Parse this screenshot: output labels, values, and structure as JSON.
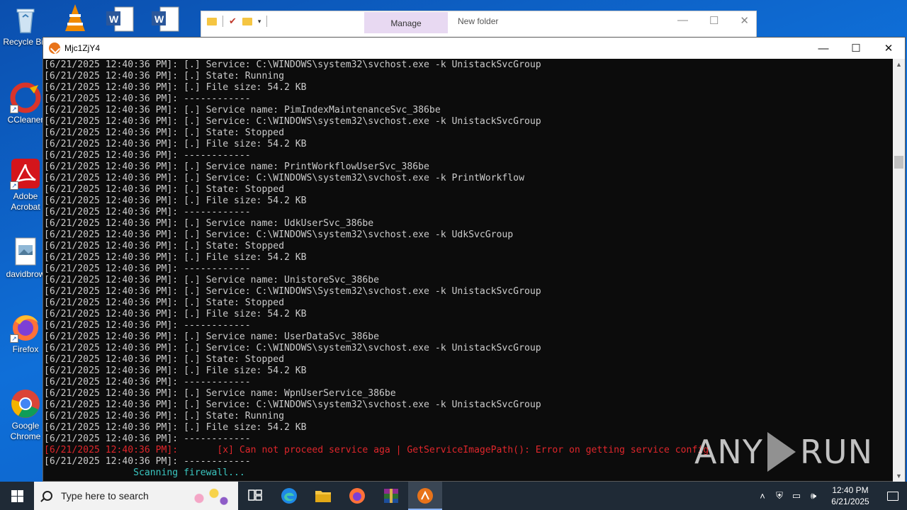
{
  "desktop": {
    "icons": [
      {
        "label": "Recycle Bin"
      },
      {
        "label": "CCleaner"
      },
      {
        "label": "Adobe Acrobat"
      },
      {
        "label": "davidbrow"
      },
      {
        "label": "Firefox"
      },
      {
        "label": "Google Chrome"
      }
    ]
  },
  "explorer": {
    "manage_tab": "Manage",
    "title": "New folder"
  },
  "console": {
    "title": "Mjc1ZjY4",
    "lines": [
      {
        "text": "[6/21/2025 12:40:36 PM]: [.] Service: C:\\WINDOWS\\system32\\svchost.exe -k UnistackSvcGroup",
        "style": "normal"
      },
      {
        "text": "[6/21/2025 12:40:36 PM]: [.] State: Running",
        "style": "normal"
      },
      {
        "text": "[6/21/2025 12:40:36 PM]: [.] File size: 54.2 KB",
        "style": "normal"
      },
      {
        "text": "[6/21/2025 12:40:36 PM]: ------------",
        "style": "normal"
      },
      {
        "text": "[6/21/2025 12:40:36 PM]: [.] Service name: PimIndexMaintenanceSvc_386be",
        "style": "normal"
      },
      {
        "text": "[6/21/2025 12:40:36 PM]: [.] Service: C:\\WINDOWS\\system32\\svchost.exe -k UnistackSvcGroup",
        "style": "normal"
      },
      {
        "text": "[6/21/2025 12:40:36 PM]: [.] State: Stopped",
        "style": "normal"
      },
      {
        "text": "[6/21/2025 12:40:36 PM]: [.] File size: 54.2 KB",
        "style": "normal"
      },
      {
        "text": "[6/21/2025 12:40:36 PM]: ------------",
        "style": "normal"
      },
      {
        "text": "[6/21/2025 12:40:36 PM]: [.] Service name: PrintWorkflowUserSvc_386be",
        "style": "normal"
      },
      {
        "text": "[6/21/2025 12:40:36 PM]: [.] Service: C:\\WINDOWS\\system32\\svchost.exe -k PrintWorkflow",
        "style": "normal"
      },
      {
        "text": "[6/21/2025 12:40:36 PM]: [.] State: Stopped",
        "style": "normal"
      },
      {
        "text": "[6/21/2025 12:40:36 PM]: [.] File size: 54.2 KB",
        "style": "normal"
      },
      {
        "text": "[6/21/2025 12:40:36 PM]: ------------",
        "style": "normal"
      },
      {
        "text": "[6/21/2025 12:40:36 PM]: [.] Service name: UdkUserSvc_386be",
        "style": "normal"
      },
      {
        "text": "[6/21/2025 12:40:36 PM]: [.] Service: C:\\WINDOWS\\system32\\svchost.exe -k UdkSvcGroup",
        "style": "normal"
      },
      {
        "text": "[6/21/2025 12:40:36 PM]: [.] State: Stopped",
        "style": "normal"
      },
      {
        "text": "[6/21/2025 12:40:36 PM]: [.] File size: 54.2 KB",
        "style": "normal"
      },
      {
        "text": "[6/21/2025 12:40:36 PM]: ------------",
        "style": "normal"
      },
      {
        "text": "[6/21/2025 12:40:36 PM]: [.] Service name: UnistoreSvc_386be",
        "style": "normal"
      },
      {
        "text": "[6/21/2025 12:40:36 PM]: [.] Service: C:\\WINDOWS\\System32\\svchost.exe -k UnistackSvcGroup",
        "style": "normal"
      },
      {
        "text": "[6/21/2025 12:40:36 PM]: [.] State: Stopped",
        "style": "normal"
      },
      {
        "text": "[6/21/2025 12:40:36 PM]: [.] File size: 54.2 KB",
        "style": "normal"
      },
      {
        "text": "[6/21/2025 12:40:36 PM]: ------------",
        "style": "normal"
      },
      {
        "text": "[6/21/2025 12:40:36 PM]: [.] Service name: UserDataSvc_386be",
        "style": "normal"
      },
      {
        "text": "[6/21/2025 12:40:36 PM]: [.] Service: C:\\WINDOWS\\system32\\svchost.exe -k UnistackSvcGroup",
        "style": "normal"
      },
      {
        "text": "[6/21/2025 12:40:36 PM]: [.] State: Stopped",
        "style": "normal"
      },
      {
        "text": "[6/21/2025 12:40:36 PM]: [.] File size: 54.2 KB",
        "style": "normal"
      },
      {
        "text": "[6/21/2025 12:40:36 PM]: ------------",
        "style": "normal"
      },
      {
        "text": "[6/21/2025 12:40:36 PM]: [.] Service name: WpnUserService_386be",
        "style": "normal"
      },
      {
        "text": "[6/21/2025 12:40:36 PM]: [.] Service: C:\\WINDOWS\\system32\\svchost.exe -k UnistackSvcGroup",
        "style": "normal"
      },
      {
        "text": "[6/21/2025 12:40:36 PM]: [.] State: Running",
        "style": "normal"
      },
      {
        "text": "[6/21/2025 12:40:36 PM]: [.] File size: 54.2 KB",
        "style": "normal"
      },
      {
        "text": "[6/21/2025 12:40:36 PM]: ------------",
        "style": "normal"
      },
      {
        "text": "[6/21/2025 12:40:36 PM]:       [x] Can not proceed service aga | GetServiceImagePath(): Error on getting service config",
        "style": "error"
      },
      {
        "text": "[6/21/2025 12:40:36 PM]: ------------",
        "style": "normal"
      },
      {
        "text": "                Scanning firewall...",
        "style": "scan"
      }
    ]
  },
  "watermark": {
    "left": "ANY",
    "right": "RUN"
  },
  "taskbar": {
    "search_placeholder": "Type here to search",
    "clock_time": "12:40 PM",
    "clock_date": "6/21/2025"
  },
  "colors": {
    "terminal_bg": "#0c0c0c",
    "terminal_fg": "#cccccc",
    "error": "#e0262b",
    "scan": "#3ac7c1"
  }
}
